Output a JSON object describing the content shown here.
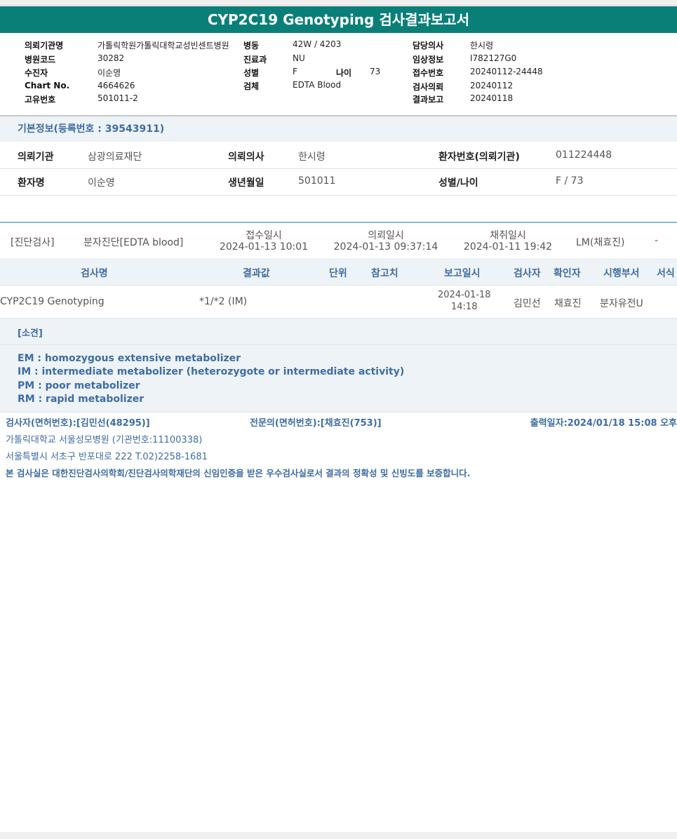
{
  "title": "CYP2C19 Genotyping 검사결과보고서",
  "header": {
    "col1": [
      {
        "label": "의뢰기관명",
        "value": "가톨릭학원가톨릭대학교성빈센트병원"
      },
      {
        "label": "병원코드",
        "value": "30282"
      },
      {
        "label": "수진자",
        "value": "이순영"
      },
      {
        "label": "Chart No.",
        "value": "4664626"
      },
      {
        "label": "고유번호",
        "value": "501011-2"
      }
    ],
    "col2": [
      {
        "label": "병동",
        "value": "42W / 4203"
      },
      {
        "label": "진료과",
        "value": "NU"
      },
      {
        "label": "성별",
        "value": "F"
      },
      {
        "label": "검체",
        "value": "EDTA Blood"
      }
    ],
    "age": {
      "label": "나이",
      "value": "73"
    },
    "col3": [
      {
        "label": "담당의사",
        "value": "한시령"
      },
      {
        "label": "임상정보",
        "value": "I782127G0"
      },
      {
        "label": "접수번호",
        "value": "20240112-24448"
      },
      {
        "label": "검사의뢰",
        "value": "20240112"
      },
      {
        "label": "결과보고",
        "value": "20240118"
      }
    ]
  },
  "basic": {
    "title": "기본정보(등록번호 : 39543911)",
    "row1": {
      "k1": "의뢰기관",
      "v1": "삼광의료재단",
      "k2": "의뢰의사",
      "v2": "한시령",
      "k3": "환자번호(의뢰기관)",
      "v3": "011224448"
    },
    "row2": {
      "k1": "환자명",
      "v1": "이순영",
      "k2": "생년월일",
      "v2": "501011",
      "k3": "성별/나이",
      "v3": "F / 73"
    }
  },
  "order": {
    "category": "[진단검사]",
    "type": "분자진단[EDTA blood]",
    "received_label": "접수일시",
    "received": "2024-01-13 10:01",
    "requested_label": "의뢰일시",
    "requested": "2024-01-13 09:37:14",
    "collected_label": "채취일시",
    "collected": "2024-01-11 19:42",
    "lm": "LM(채효진)",
    "dash": "-"
  },
  "table": {
    "headers": {
      "name": "검사명",
      "result": "결과값",
      "unit": "단위",
      "ref": "참고치",
      "reported": "보고일시",
      "tester": "검사자",
      "confirmer": "확인자",
      "dept": "시행부서",
      "form": "서식"
    },
    "row": {
      "name": "CYP2C19 Genotyping",
      "result": "*1/*2 (IM)",
      "reported_date": "2024-01-18",
      "reported_time": "14:18",
      "tester": "김민선",
      "confirmer": "채효진",
      "dept": "분자유전U"
    }
  },
  "opinion": {
    "title": "[소견]",
    "lines": [
      "EM : homozygous extensive metabolizer",
      "IM  : intermediate metabolizer (heterozygote or intermediate activity)",
      "PM : poor metabolizer",
      "RM : rapid metabolizer"
    ]
  },
  "footer": {
    "tester": "검사자(면허번호):[김민선(48295)]",
    "specialist": "전문의(면허번호):[채효진(753)]",
    "printed": "출력일자:2024/01/18 15:08 오후",
    "hospital": "가톨릭대학교 서울성모병원 (기관번호:11100338)",
    "address": "서울특별시 서초구 반포대로 222 T.02)2258-1681",
    "certification": "본 검사실은 대한진단검사의학회/진단검사의학재단의 신임인증을 받은 우수검사실로서 결과의 정확성 및 신빙도를 보증합니다."
  }
}
